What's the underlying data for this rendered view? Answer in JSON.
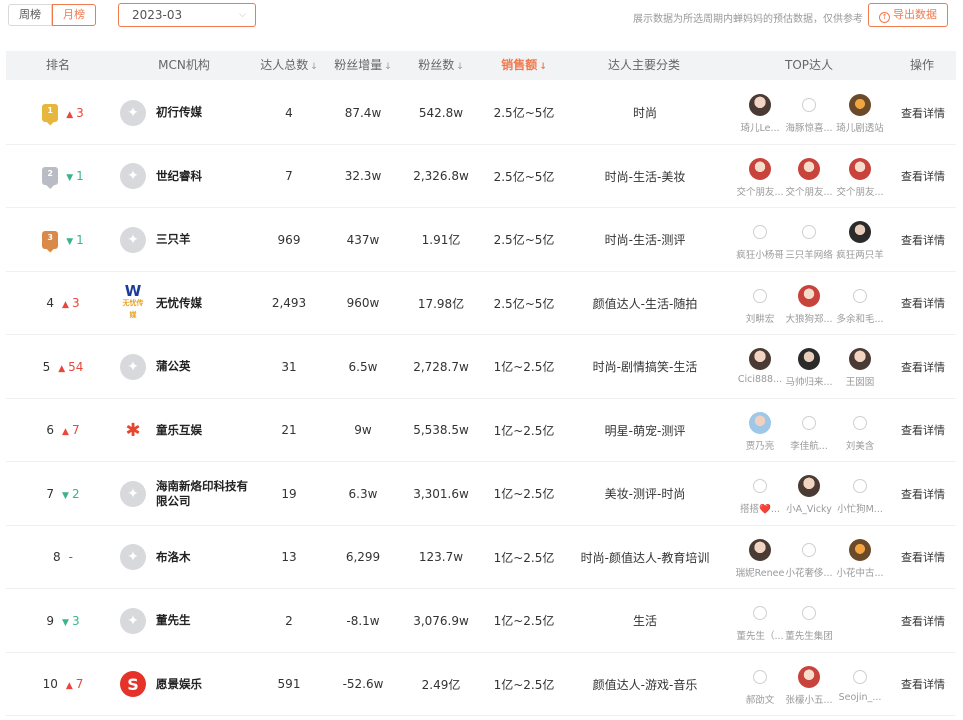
{
  "toolbar": {
    "tab_week": "周榜",
    "tab_month": "月榜",
    "active_tab": "月榜",
    "month_value": "2023-03",
    "notice": "展示数据为所选周期内蝉妈妈的预估数据，仅供参考",
    "export_label": "导出数据",
    "accent_color": "#f07a4e"
  },
  "columns": {
    "rank": "排名",
    "org": "MCN机构",
    "talent_count": "达人总数",
    "fans_growth": "粉丝增量",
    "fans": "粉丝数",
    "sales": "销售额",
    "category": "达人主要分类",
    "top": "TOP达人",
    "action": "操作",
    "sort_mark": "↓"
  },
  "rows": [
    {
      "rank": "1",
      "medal": "gold",
      "change_dir": "up",
      "change": "3",
      "org": "初行传媒",
      "logo": "star",
      "talent_count": "4",
      "fans_growth": "87.4w",
      "fans": "542.8w",
      "sales": "2.5亿~5亿",
      "category": "时尚",
      "tops": [
        {
          "name": "琦儿Le...",
          "av": "photo"
        },
        {
          "name": "海豚惊喜...",
          "av": "empty"
        },
        {
          "name": "琦儿剧透站",
          "av": "photo5"
        }
      ],
      "action": "查看详情"
    },
    {
      "rank": "2",
      "medal": "silver",
      "change_dir": "down",
      "change": "1",
      "org": "世纪睿科",
      "logo": "star",
      "talent_count": "7",
      "fans_growth": "32.3w",
      "fans": "2,326.8w",
      "sales": "2.5亿~5亿",
      "category": "时尚-生活-美妆",
      "tops": [
        {
          "name": "交个朋友...",
          "av": "photo2"
        },
        {
          "name": "交个朋友...",
          "av": "photo2"
        },
        {
          "name": "交个朋友...",
          "av": "photo2"
        }
      ],
      "action": "查看详情"
    },
    {
      "rank": "3",
      "medal": "bronze",
      "change_dir": "down",
      "change": "1",
      "org": "三只羊",
      "logo": "star",
      "talent_count": "969",
      "fans_growth": "437w",
      "fans": "1.91亿",
      "sales": "2.5亿~5亿",
      "category": "时尚-生活-测评",
      "tops": [
        {
          "name": "疯狂小杨哥",
          "av": "empty"
        },
        {
          "name": "三只羊网络",
          "av": "empty"
        },
        {
          "name": "疯狂两只羊",
          "av": "photo3"
        }
      ],
      "action": "查看详情"
    },
    {
      "rank": "4",
      "medal": "",
      "change_dir": "up",
      "change": "3",
      "org": "无忧传媒",
      "logo": "w",
      "talent_count": "2,493",
      "fans_growth": "960w",
      "fans": "17.98亿",
      "sales": "2.5亿~5亿",
      "category": "颜值达人-生活-随拍",
      "tops": [
        {
          "name": "刘畊宏",
          "av": "empty"
        },
        {
          "name": "大狼狗郑...",
          "av": "photo2"
        },
        {
          "name": "多余和毛...",
          "av": "empty"
        }
      ],
      "action": "查看详情"
    },
    {
      "rank": "5",
      "medal": "",
      "change_dir": "up",
      "change": "54",
      "org": "蒲公英",
      "logo": "star",
      "talent_count": "31",
      "fans_growth": "6.5w",
      "fans": "2,728.7w",
      "sales": "1亿~2.5亿",
      "category": "时尚-剧情搞笑-生活",
      "tops": [
        {
          "name": "Cici888...",
          "av": "photo"
        },
        {
          "name": "马帅归来...",
          "av": "photo3"
        },
        {
          "name": "王囡囡",
          "av": "photo"
        }
      ],
      "action": "查看详情"
    },
    {
      "rank": "6",
      "medal": "",
      "change_dir": "up",
      "change": "7",
      "org": "童乐互娱",
      "logo": "tl",
      "talent_count": "21",
      "fans_growth": "9w",
      "fans": "5,538.5w",
      "sales": "1亿~2.5亿",
      "category": "明星-萌宠-测评",
      "tops": [
        {
          "name": "贾乃亮",
          "av": "photo4"
        },
        {
          "name": "李佳航...",
          "av": "empty"
        },
        {
          "name": "刘美含",
          "av": "empty"
        }
      ],
      "action": "查看详情"
    },
    {
      "rank": "7",
      "medal": "",
      "change_dir": "down",
      "change": "2",
      "org": "海南新烙印科技有限公司",
      "logo": "star",
      "talent_count": "19",
      "fans_growth": "6.3w",
      "fans": "3,301.6w",
      "sales": "1亿~2.5亿",
      "category": "美妆-测评-时尚",
      "tops": [
        {
          "name": "搭搭❤️...",
          "av": "empty"
        },
        {
          "name": "小A_Vicky",
          "av": "photo"
        },
        {
          "name": "小忙狗M...",
          "av": "empty"
        }
      ],
      "action": "查看详情"
    },
    {
      "rank": "8",
      "medal": "",
      "change_dir": "same",
      "change": "-",
      "org": "布洛木",
      "logo": "star",
      "talent_count": "13",
      "fans_growth": "6,299",
      "fans": "123.7w",
      "sales": "1亿~2.5亿",
      "category": "时尚-颜值达人-教育培训",
      "tops": [
        {
          "name": "瑞妮Renee",
          "av": "photo"
        },
        {
          "name": "小花奢侈...",
          "av": "empty"
        },
        {
          "name": "小花中古...",
          "av": "photo5"
        }
      ],
      "action": "查看详情"
    },
    {
      "rank": "9",
      "medal": "",
      "change_dir": "down",
      "change": "3",
      "org": "董先生",
      "logo": "star",
      "talent_count": "2",
      "fans_growth": "-8.1w",
      "fans": "3,076.9w",
      "sales": "1亿~2.5亿",
      "category": "生活",
      "tops": [
        {
          "name": "董先生（...",
          "av": "empty"
        },
        {
          "name": "董先生集团",
          "av": "empty"
        }
      ],
      "action": "查看详情"
    },
    {
      "rank": "10",
      "medal": "",
      "change_dir": "up",
      "change": "7",
      "org": "愿景娱乐",
      "logo": "s",
      "talent_count": "591",
      "fans_growth": "-52.6w",
      "fans": "2.49亿",
      "sales": "1亿~2.5亿",
      "category": "颜值达人-游戏-音乐",
      "tops": [
        {
          "name": "郝劭文",
          "av": "empty"
        },
        {
          "name": "张檬小五...",
          "av": "photo2"
        },
        {
          "name": "Seojin_...",
          "av": "empty"
        }
      ],
      "action": "查看详情"
    }
  ]
}
